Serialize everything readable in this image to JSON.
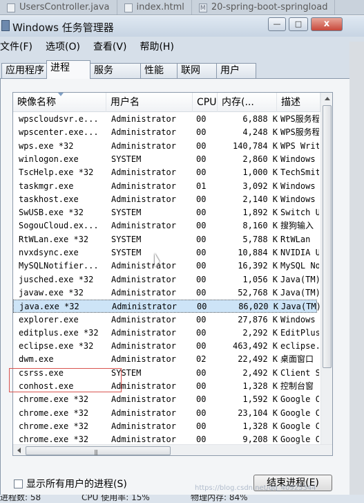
{
  "editor_tabs": [
    "UsersController.java",
    "index.html",
    "20-spring-boot-springload"
  ],
  "window": {
    "title": "Windows 任务管理器",
    "min": "—",
    "max": "□",
    "close": "x"
  },
  "menu": [
    "文件(F)",
    "选项(O)",
    "查看(V)",
    "帮助(H)"
  ],
  "tabs": [
    "应用程序",
    "进程",
    "服务",
    "性能",
    "联网",
    "用户"
  ],
  "active_tab": "进程",
  "columns": {
    "name": "映像名称",
    "user": "用户名",
    "cpu": "CPU",
    "mem": "内存(...",
    "desc": "描述"
  },
  "processes": [
    {
      "name": "wpscloudsvr.e...",
      "user": "Administrator",
      "cpu": "00",
      "mem": "6,888 K",
      "desc": "WPS服务程序"
    },
    {
      "name": "wpscenter.exe...",
      "user": "Administrator",
      "cpu": "00",
      "mem": "4,248 K",
      "desc": "WPS服务程序"
    },
    {
      "name": "wps.exe *32",
      "user": "Administrator",
      "cpu": "00",
      "mem": "140,784 K",
      "desc": "WPS Writer"
    },
    {
      "name": "winlogon.exe",
      "user": "SYSTEM",
      "cpu": "00",
      "mem": "2,860 K",
      "desc": "Windows"
    },
    {
      "name": "TscHelp.exe *32",
      "user": "Administrator",
      "cpu": "00",
      "mem": "1,000 K",
      "desc": "TechSmith"
    },
    {
      "name": "taskmgr.exe",
      "user": "Administrator",
      "cpu": "01",
      "mem": "3,092 K",
      "desc": "Windows"
    },
    {
      "name": "taskhost.exe",
      "user": "Administrator",
      "cpu": "00",
      "mem": "2,140 K",
      "desc": "Windows"
    },
    {
      "name": "SwUSB.exe *32",
      "user": "SYSTEM",
      "cpu": "00",
      "mem": "1,892 K",
      "desc": "Switch U"
    },
    {
      "name": "SogouCloud.ex...",
      "user": "Administrator",
      "cpu": "00",
      "mem": "8,160 K",
      "desc": "搜狗输入"
    },
    {
      "name": "RtWLan.exe *32",
      "user": "SYSTEM",
      "cpu": "00",
      "mem": "5,788 K",
      "desc": "RtWLan"
    },
    {
      "name": "nvxdsync.exe",
      "user": "SYSTEM",
      "cpu": "00",
      "mem": "10,884 K",
      "desc": "NVIDIA U"
    },
    {
      "name": "MySQLNotifier...",
      "user": "Administrator",
      "cpu": "00",
      "mem": "16,392 K",
      "desc": "MySQL No"
    },
    {
      "name": "jusched.exe *32",
      "user": "Administrator",
      "cpu": "00",
      "mem": "1,056 K",
      "desc": "Java(TM)"
    },
    {
      "name": "javaw.exe *32",
      "user": "Administrator",
      "cpu": "00",
      "mem": "52,768 K",
      "desc": "Java(TM)"
    },
    {
      "name": "java.exe *32",
      "user": "Administrator",
      "cpu": "00",
      "mem": "86,020 K",
      "desc": "Java(TM)"
    },
    {
      "name": "explorer.exe",
      "user": "Administrator",
      "cpu": "00",
      "mem": "27,876 K",
      "desc": "Windows"
    },
    {
      "name": "editplus.exe *32",
      "user": "Administrator",
      "cpu": "00",
      "mem": "2,292 K",
      "desc": "EditPlus"
    },
    {
      "name": "eclipse.exe *32",
      "user": "Administrator",
      "cpu": "00",
      "mem": "463,492 K",
      "desc": "eclipse."
    },
    {
      "name": "dwm.exe",
      "user": "Administrator",
      "cpu": "02",
      "mem": "22,492 K",
      "desc": "桌面窗口"
    },
    {
      "name": "csrss.exe",
      "user": "SYSTEM",
      "cpu": "00",
      "mem": "2,492 K",
      "desc": "Client S"
    },
    {
      "name": "conhost.exe",
      "user": "Administrator",
      "cpu": "00",
      "mem": "1,328 K",
      "desc": "控制台窗"
    },
    {
      "name": "chrome.exe *32",
      "user": "Administrator",
      "cpu": "00",
      "mem": "1,592 K",
      "desc": "Google C"
    },
    {
      "name": "chrome.exe *32",
      "user": "Administrator",
      "cpu": "00",
      "mem": "23,104 K",
      "desc": "Google C"
    },
    {
      "name": "chrome.exe *32",
      "user": "Administrator",
      "cpu": "00",
      "mem": "1,328 K",
      "desc": "Google C"
    },
    {
      "name": "chrome.exe *32",
      "user": "Administrator",
      "cpu": "00",
      "mem": "9,208 K",
      "desc": "Google C"
    }
  ],
  "selected_process": "java.exe *32",
  "show_all_label": "显示所有用户的进程(S)",
  "end_process_label": "结束进程(E)",
  "status": {
    "processes": "进程数: 58",
    "cpu": "CPU 使用率: 15%",
    "memory": "物理内存: 84%"
  },
  "watermark": "https://blog.csdn.net/qq_40925344"
}
